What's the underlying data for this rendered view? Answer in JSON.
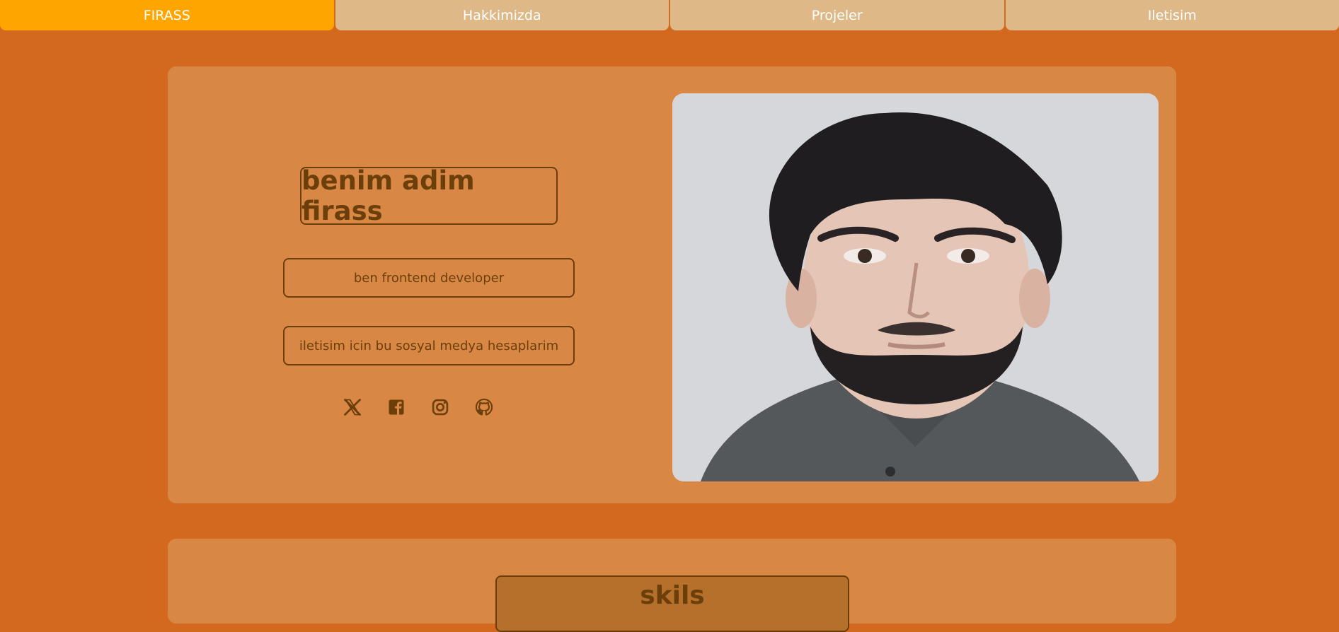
{
  "nav": {
    "items": [
      {
        "label": "FIRASS"
      },
      {
        "label": "Hakkimizda"
      },
      {
        "label": "Projeler"
      },
      {
        "label": "Iletisim"
      }
    ]
  },
  "hero": {
    "name": "benim adim firass",
    "role": "ben frontend developer",
    "contact_text": "iletisim icin bu sosyal medya hesaplarim",
    "socials": [
      {
        "icon": "x-twitter-icon"
      },
      {
        "icon": "facebook-icon"
      },
      {
        "icon": "instagram-icon"
      },
      {
        "icon": "github-icon"
      }
    ]
  },
  "skills": {
    "title": "skils"
  },
  "colors": {
    "background": "#d2691e",
    "card": "#d88844",
    "nav_active": "#ffa500",
    "nav_inactive": "#deb887",
    "text_brown": "#6b3e0a"
  }
}
